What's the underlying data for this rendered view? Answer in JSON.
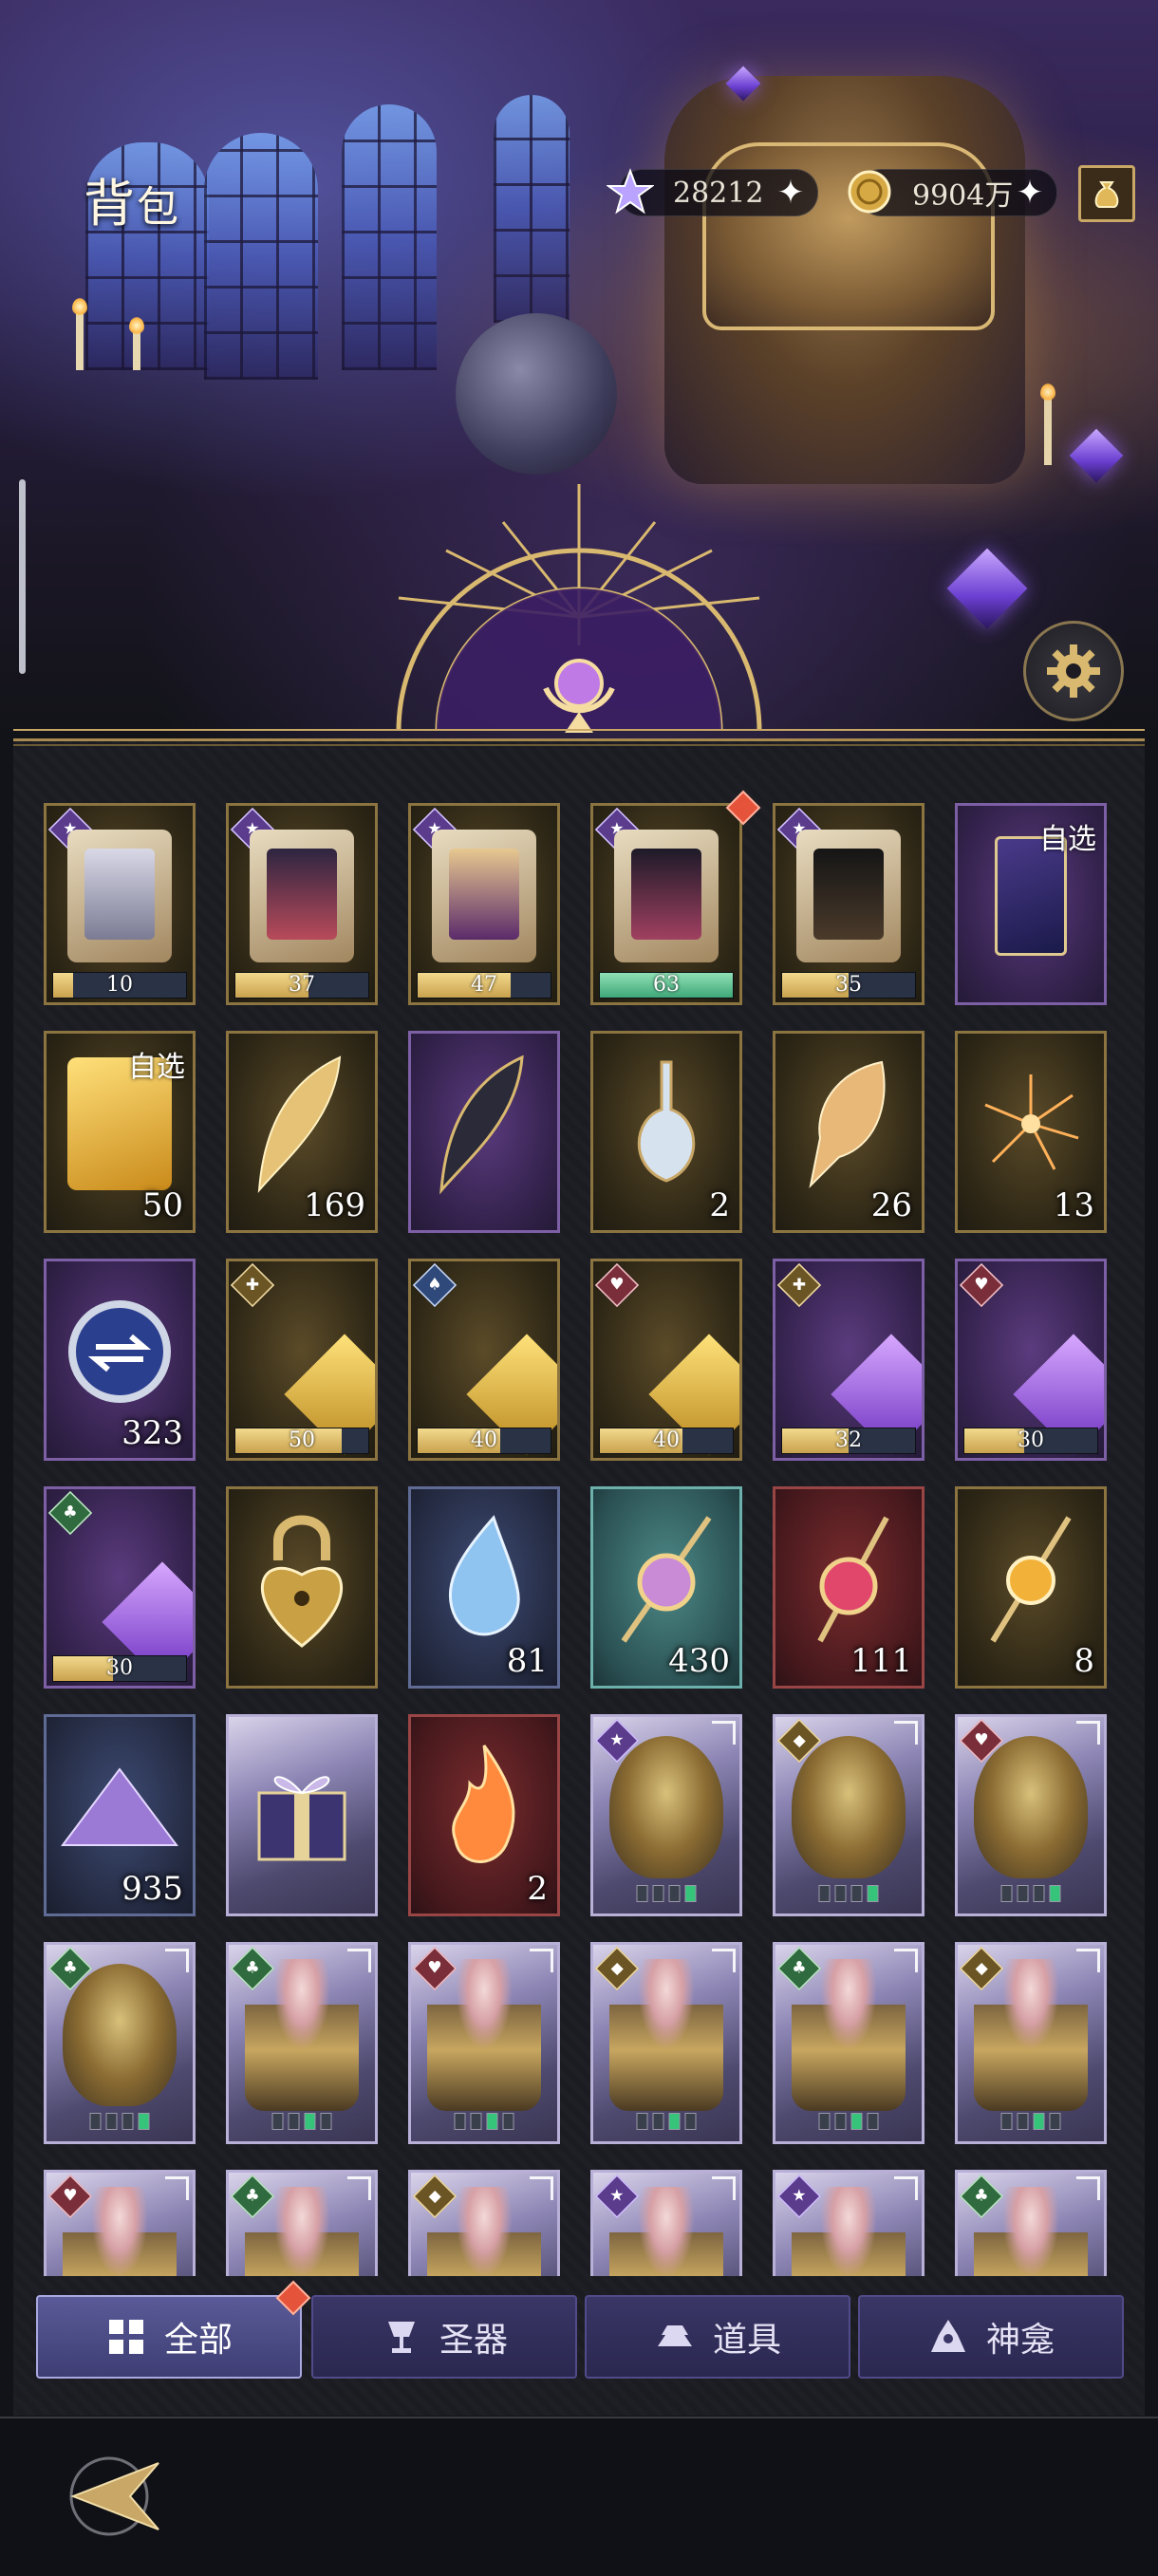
{
  "header": {
    "title_big": "背",
    "title_small": "包"
  },
  "currencies": [
    {
      "icon": "star-gem-icon",
      "value": "28212"
    },
    {
      "icon": "gold-coin-icon",
      "value": "9904万"
    }
  ],
  "grid": {
    "row1": [
      {
        "type": "fragment",
        "progress": "10",
        "fill": 0.15
      },
      {
        "type": "fragment",
        "progress": "37",
        "fill": 0.55
      },
      {
        "type": "fragment",
        "progress": "47",
        "fill": 0.7
      },
      {
        "type": "fragment",
        "progress": "63",
        "fill": 1.0
      },
      {
        "type": "fragment",
        "progress": "35",
        "fill": 0.5
      },
      {
        "type": "select-card",
        "label": "自选"
      }
    ],
    "row2": [
      {
        "type": "select-fragment",
        "label": "自选",
        "count": "50"
      },
      {
        "type": "golden-feather",
        "count": "169"
      },
      {
        "type": "dark-feather",
        "count": ""
      },
      {
        "type": "potion",
        "count": "2"
      },
      {
        "type": "conch",
        "count": "26"
      },
      {
        "type": "firework",
        "count": "13"
      }
    ],
    "row3": [
      {
        "type": "coin-token",
        "count": "323"
      },
      {
        "type": "gold-shard",
        "progress": "50",
        "fill": 0.8
      },
      {
        "type": "gold-shard",
        "progress": "40",
        "fill": 0.62
      },
      {
        "type": "gold-shard",
        "progress": "40",
        "fill": 0.62
      },
      {
        "type": "purple-shard",
        "progress": "32",
        "fill": 0.5
      },
      {
        "type": "purple-shard",
        "progress": "30",
        "fill": 0.45
      }
    ],
    "row4": [
      {
        "type": "purple-shard",
        "progress": "30",
        "fill": 0.45
      },
      {
        "type": "heart-lock",
        "count": ""
      },
      {
        "type": "tear-gem",
        "count": "81"
      },
      {
        "type": "scepter",
        "count": "430"
      },
      {
        "type": "red-scepter",
        "count": "111"
      },
      {
        "type": "orb-scepter",
        "count": "8"
      }
    ],
    "row5": [
      {
        "type": "crystal-pile",
        "count": "935"
      },
      {
        "type": "gift-box",
        "count": ""
      },
      {
        "type": "flame",
        "count": "2"
      },
      {
        "type": "sacred-card",
        "count": ""
      },
      {
        "type": "sacred-card",
        "count": ""
      },
      {
        "type": "sacred-card",
        "count": ""
      }
    ]
  },
  "tabs": [
    {
      "label": "全部",
      "icon": "grid-icon"
    },
    {
      "label": "圣器",
      "icon": "chalice-icon"
    },
    {
      "label": "道具",
      "icon": "ingot-icon"
    },
    {
      "label": "神龛",
      "icon": "shrine-icon"
    }
  ],
  "colors": {
    "accent_gold": "#c9a767",
    "tab_active": "#5a5a98",
    "progress_fill": "#d9b55f",
    "alert_red": "#e6533b"
  }
}
